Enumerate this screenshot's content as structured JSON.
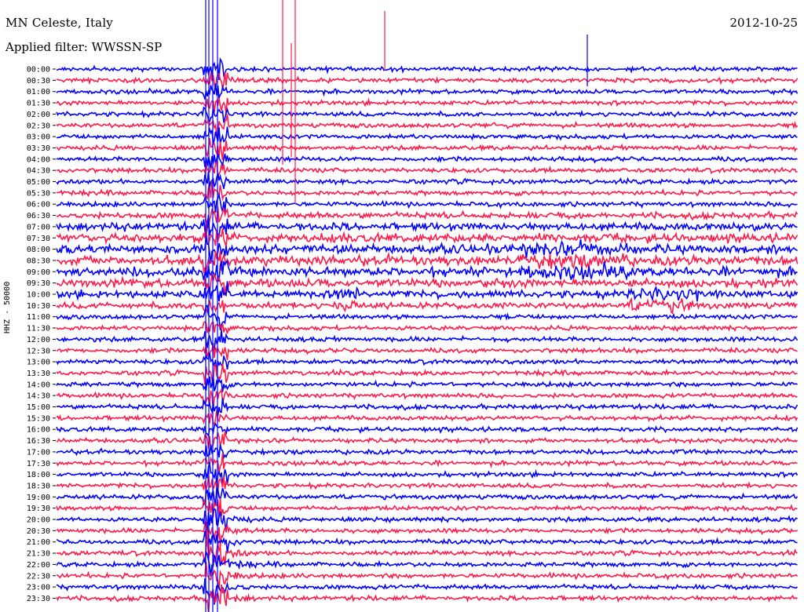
{
  "header": {
    "station": "MN Celeste, Italy",
    "date": "2012-10-25",
    "filter": "Applied filter: WWSSN-SP"
  },
  "chart_data": {
    "type": "line",
    "title": "MN Celeste, Italy",
    "ylabel": "HHZ - 50000",
    "y_tick_labels": [
      "00:00",
      "00:30",
      "01:00",
      "01:30",
      "02:00",
      "02:30",
      "03:00",
      "03:30",
      "04:00",
      "04:30",
      "05:00",
      "05:30",
      "06:00",
      "06:30",
      "07:00",
      "07:30",
      "08:00",
      "08:30",
      "09:00",
      "09:30",
      "10:00",
      "10:30",
      "11:00",
      "11:30",
      "12:00",
      "12:30",
      "13:00",
      "13:30",
      "14:00",
      "14:30",
      "15:00",
      "15:30",
      "16:00",
      "16:30",
      "17:00",
      "17:30",
      "18:00",
      "18:30",
      "19:00",
      "19:30",
      "20:00",
      "20:30",
      "21:00",
      "21:30",
      "22:00",
      "22:30",
      "23:00",
      "23:30"
    ],
    "trace_colors": [
      "#0000ff",
      "#ff1a4a"
    ],
    "grid": false,
    "legend": "none"
  }
}
